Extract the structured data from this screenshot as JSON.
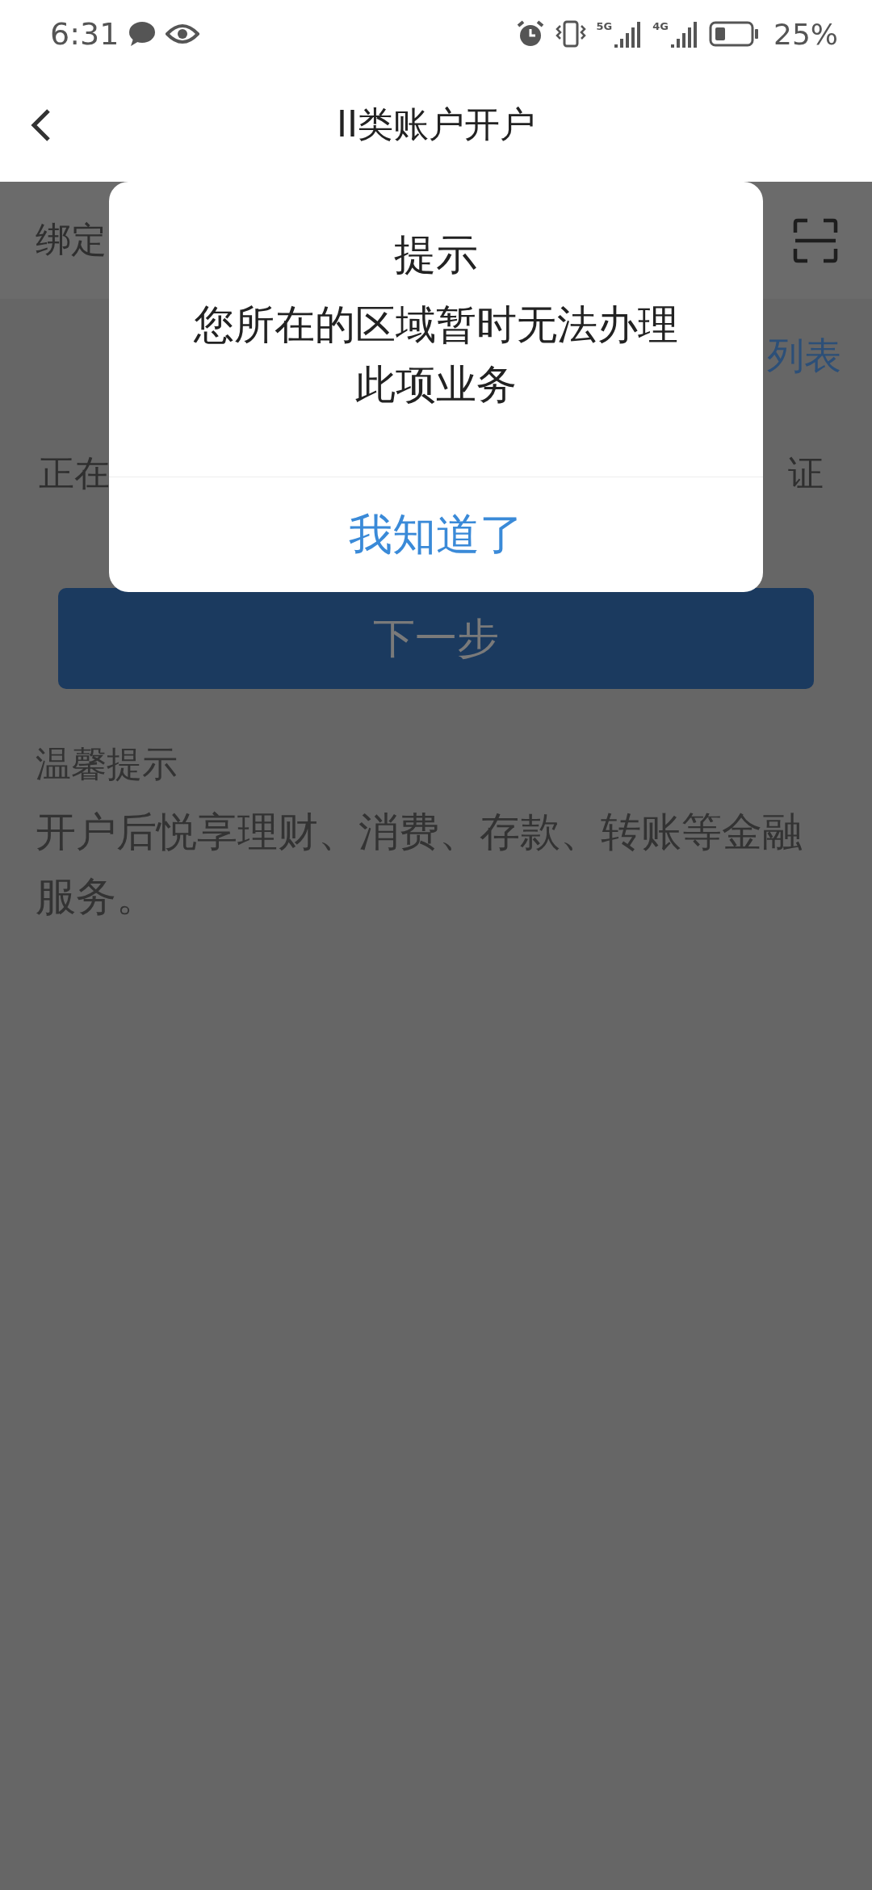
{
  "status_bar": {
    "time": "6:31",
    "network_labels": [
      "5G",
      "4G"
    ],
    "battery": "25%"
  },
  "header": {
    "title": "II类账户开户"
  },
  "page": {
    "bind_label": "绑定",
    "link": "列表",
    "status_left": "正在",
    "status_right": "证",
    "next_button": {
      "label": "下一步",
      "disabled": true
    },
    "tips_title": "温馨提示",
    "tips_text": "开户后悦享理财、消费、存款、转账等金融服务。"
  },
  "dialog": {
    "title": "提示",
    "message": "您所在的区域暂时无法办理此项业务",
    "confirm": "我知道了"
  }
}
